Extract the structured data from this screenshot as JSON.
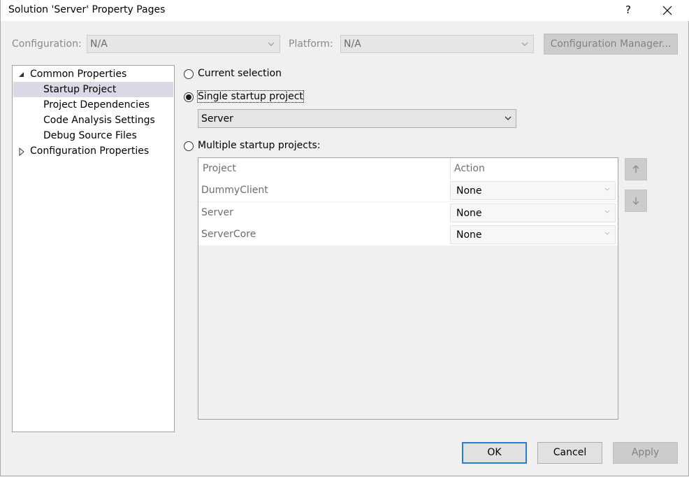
{
  "window": {
    "title": "Solution 'Server' Property Pages",
    "help": "?"
  },
  "toolbar": {
    "configuration_label": "Configuration:",
    "configuration_value": "N/A",
    "platform_label": "Platform:",
    "platform_value": "N/A",
    "config_manager_label": "Configuration Manager..."
  },
  "tree": {
    "common_properties": "Common Properties",
    "items": [
      "Startup Project",
      "Project Dependencies",
      "Code Analysis Settings",
      "Debug Source Files"
    ],
    "configuration_properties": "Configuration Properties",
    "selected": "Startup Project"
  },
  "startup": {
    "current_selection_label": "Current selection",
    "single_label": "Single startup project",
    "single_value": "Server",
    "multiple_label": "Multiple startup projects:",
    "selected_option": "single"
  },
  "grid": {
    "columns": [
      "Project",
      "Action"
    ],
    "rows": [
      {
        "project": "DummyClient",
        "action": "None"
      },
      {
        "project": "Server",
        "action": "None"
      },
      {
        "project": "ServerCore",
        "action": "None"
      }
    ]
  },
  "buttons": {
    "ok": "OK",
    "cancel": "Cancel",
    "apply": "Apply"
  },
  "colors": {
    "focus_border": "#2b7bd0",
    "selection": "#d9d9e6",
    "disabled_text": "#838383"
  }
}
